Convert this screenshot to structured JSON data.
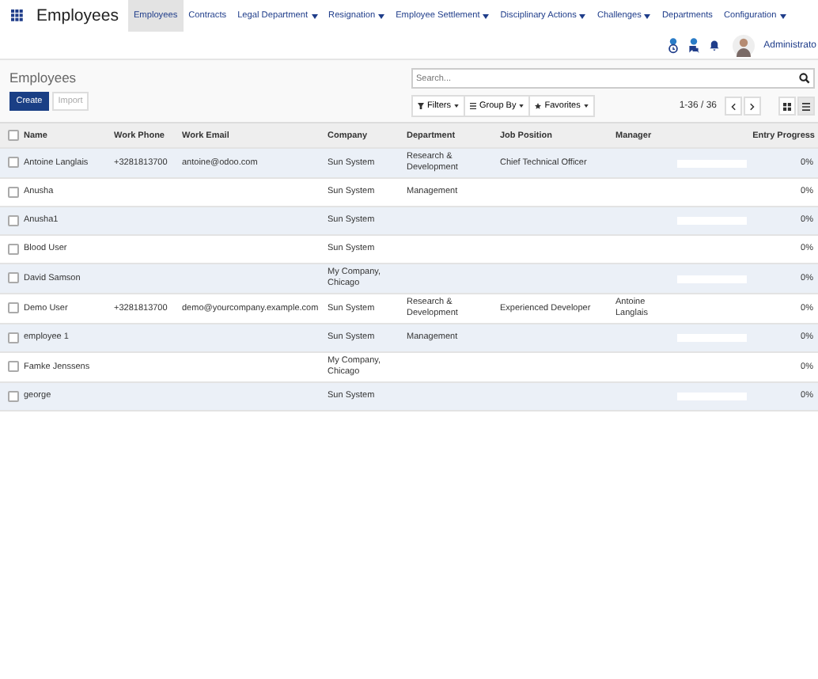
{
  "navbar": {
    "app_title": "Employees",
    "menus": [
      {
        "label": "Employees",
        "selected": true,
        "dropdown": false
      },
      {
        "label": "Contracts",
        "selected": false,
        "dropdown": false
      },
      {
        "label": "Legal Department",
        "selected": false,
        "dropdown": true
      },
      {
        "label": "Resignation",
        "selected": false,
        "dropdown": true
      },
      {
        "label": "Employee Settlement",
        "selected": false,
        "dropdown": true
      },
      {
        "label": "Disciplinary Actions",
        "selected": false,
        "dropdown": true
      },
      {
        "label": "Challenges",
        "selected": false,
        "dropdown": true
      },
      {
        "label": "Departments",
        "selected": false,
        "dropdown": false
      },
      {
        "label": "Configuration",
        "selected": false,
        "dropdown": true
      }
    ],
    "user": "Administrato"
  },
  "control_panel": {
    "title": "Employees",
    "buttons": [
      "Create",
      "Import"
    ],
    "search": {
      "placeholder": "Search..."
    },
    "filters": [
      "Filters",
      "Group By",
      "Favorites"
    ],
    "pager": "1-36 / 36"
  },
  "table": {
    "all_checked": false,
    "columns": [
      "Name",
      "Work Phone",
      "Work Email",
      "Company",
      "Department",
      "Job Position",
      "Manager",
      "Entry Progress"
    ],
    "rows": [
      {
        "name": "Antoine Langlais",
        "checked": false,
        "phone": "+3281813700",
        "email": "antoine@odoo.com",
        "company": "Sun System",
        "department": "Research & Development",
        "job": "Chief Technical Officer",
        "manager": "",
        "level": 0,
        "progress": "0%"
      },
      {
        "name": "Anusha",
        "checked": false,
        "phone": "",
        "email": "",
        "company": "Sun System",
        "department": "Management",
        "job": "",
        "manager": "",
        "progress": "0%"
      },
      {
        "name": "Anusha1",
        "checked": false,
        "phone": "",
        "email": "",
        "company": "Sun System",
        "department": "",
        "job": "",
        "manager": "",
        "level": 0,
        "progress": "0%"
      },
      {
        "name": "Blood User",
        "checked": false,
        "phone": "",
        "email": "",
        "company": "Sun System",
        "department": "",
        "job": "",
        "manager": "",
        "progress": "0%"
      },
      {
        "name": "David Samson",
        "checked": false,
        "phone": "",
        "email": "",
        "company": "My Company, Chicago",
        "department": "",
        "job": "",
        "manager": "",
        "level": 0,
        "progress": "0%"
      },
      {
        "name": "Demo User",
        "checked": false,
        "phone": "+3281813700",
        "email": "demo@yourcompany.example.com",
        "company": "Sun System",
        "department": "Research & Development",
        "job": "Experienced Developer",
        "manager": "Antoine Langlais",
        "progress": "0%"
      },
      {
        "name": "employee 1",
        "checked": false,
        "phone": "",
        "email": "",
        "company": "Sun System",
        "department": "Management",
        "job": "",
        "manager": "",
        "level": 0,
        "progress": "0%"
      },
      {
        "name": "Famke Jenssens",
        "checked": false,
        "phone": "",
        "email": "",
        "company": "My Company, Chicago",
        "department": "",
        "job": "",
        "manager": "",
        "progress": "0%"
      },
      {
        "name": "george",
        "checked": false,
        "phone": "",
        "email": "",
        "company": "Sun System",
        "department": "",
        "job": "",
        "manager": "",
        "level": 0,
        "progress": "0%"
      }
    ]
  }
}
